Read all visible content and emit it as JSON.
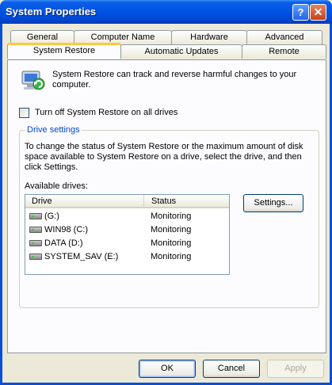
{
  "window": {
    "title": "System Properties",
    "help_button": "?",
    "close_button": "✕"
  },
  "tabs": {
    "row1": [
      "General",
      "Computer Name",
      "Hardware",
      "Advanced"
    ],
    "row2": [
      "System Restore",
      "Automatic Updates",
      "Remote"
    ],
    "active": "System Restore"
  },
  "intro_text": "System Restore can track and reverse harmful changes to your computer.",
  "turn_off_checkbox": {
    "label": "Turn off System Restore on all drives",
    "checked": false
  },
  "drive_settings": {
    "title": "Drive settings",
    "description": "To change the status of System Restore or the maximum amount of disk space available to System Restore on a drive, select the drive, and then click Settings.",
    "available_label": "Available drives:",
    "columns": [
      "Drive",
      "Status"
    ],
    "drives": [
      {
        "name": " (G:)",
        "status": "Monitoring"
      },
      {
        "name": "WIN98 (C:)",
        "status": "Monitoring"
      },
      {
        "name": "DATA (D:)",
        "status": "Monitoring"
      },
      {
        "name": "SYSTEM_SAV (E:)",
        "status": "Monitoring"
      }
    ],
    "settings_button": "Settings..."
  },
  "buttons": {
    "ok": "OK",
    "cancel": "Cancel",
    "apply": "Apply"
  },
  "icons": {
    "title_help": "help-icon",
    "title_close": "close-icon",
    "system_restore": "system-restore-icon",
    "drive": "hard-drive-icon"
  },
  "colors": {
    "titlebar": "#0054e3",
    "tab_highlight": "#ffc83c",
    "group_title": "#0046d5"
  }
}
